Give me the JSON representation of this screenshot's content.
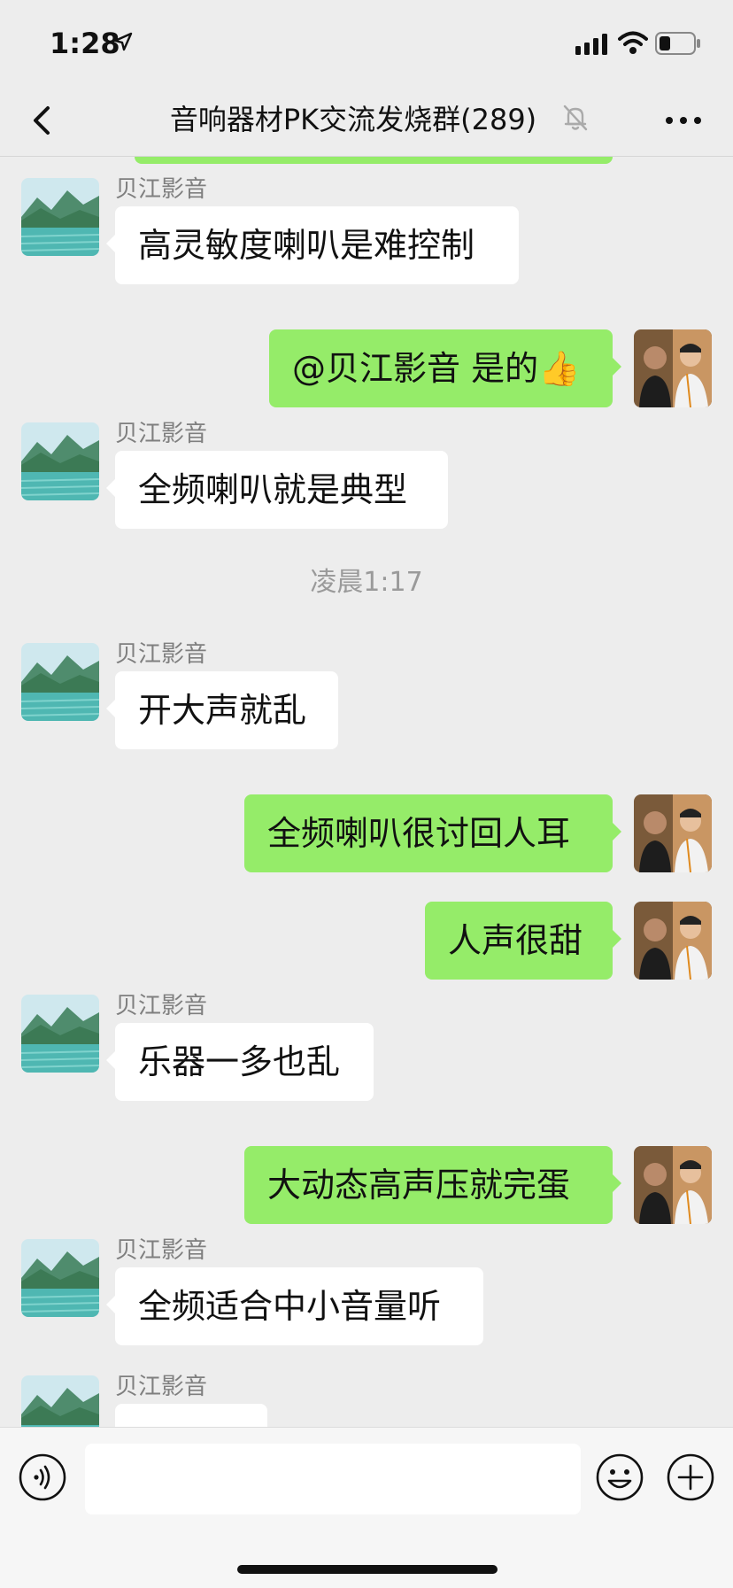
{
  "status_bar": {
    "time": "1:28"
  },
  "nav": {
    "title": "音响器材PK交流发烧群(289)"
  },
  "colors": {
    "accent_green": "#95ec69",
    "background": "#ededed",
    "incoming_bubble": "#ffffff"
  },
  "messages": [
    {
      "direction": "in",
      "sender": "贝江影音",
      "text": "高灵敏度喇叭是难控制"
    },
    {
      "direction": "out",
      "text": "@贝江影音 是的👍"
    },
    {
      "direction": "in",
      "sender": "贝江影音",
      "text": "全频喇叭就是典型"
    },
    {
      "type": "time",
      "text": "凌晨1:17"
    },
    {
      "direction": "in",
      "sender": "贝江影音",
      "text": "开大声就乱"
    },
    {
      "direction": "out",
      "text": "全频喇叭很讨回人耳"
    },
    {
      "direction": "out",
      "text": "人声很甜"
    },
    {
      "direction": "in",
      "sender": "贝江影音",
      "text": "乐器一多也乱"
    },
    {
      "direction": "out",
      "text": "大动态高声压就完蛋"
    },
    {
      "direction": "in",
      "sender": "贝江影音",
      "text": "全频适合中小音量听"
    },
    {
      "direction": "in",
      "sender": "贝江影音",
      "text": ""
    }
  ],
  "input": {
    "placeholder": ""
  },
  "icons": {
    "back": "chevron-left-icon",
    "mute": "bell-slash-icon",
    "more": "ellipsis-icon",
    "voice": "voice-icon",
    "emoji": "smile-icon",
    "plus": "plus-icon"
  }
}
